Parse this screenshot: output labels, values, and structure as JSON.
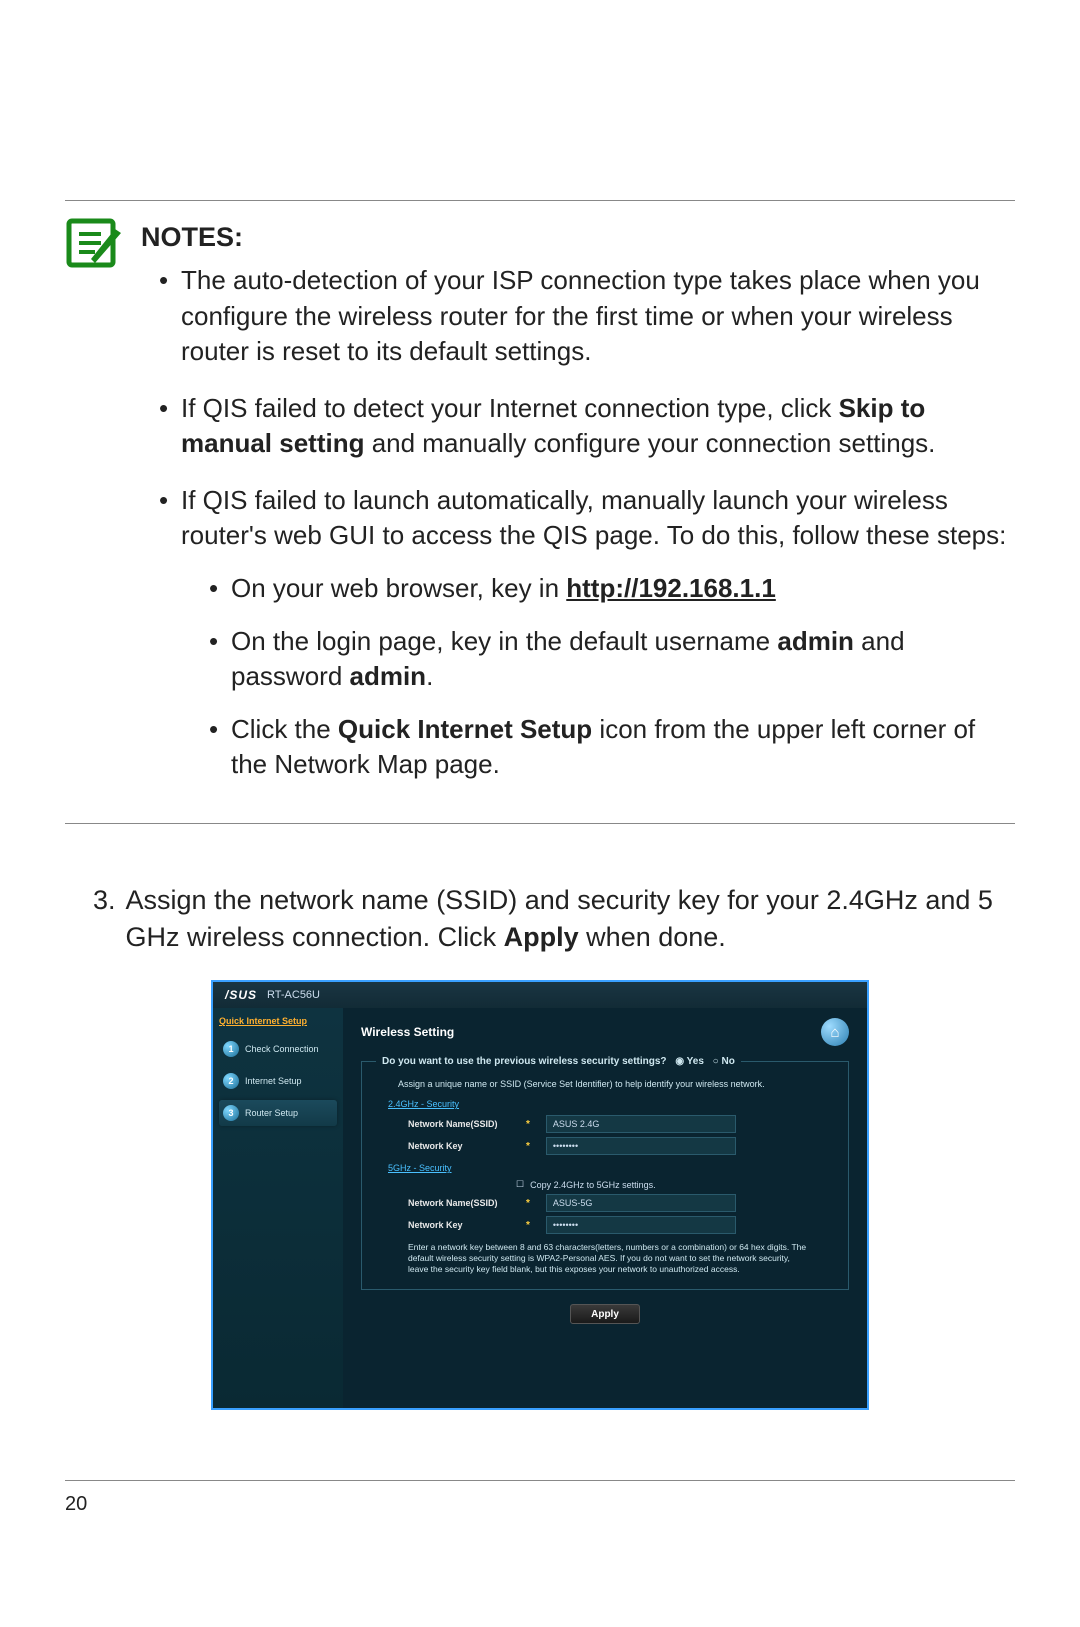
{
  "notes": {
    "title": "NOTES",
    "items": [
      {
        "text": "The auto-detection of your ISP connection type takes place when you configure the wireless router for the first time or when your wireless router is reset to its default settings."
      },
      {
        "prefix": "If QIS failed to detect your Internet connection type, click ",
        "b1": "Skip to manual setting",
        "suffix": " and manually configure your connection settings."
      },
      {
        "text": "If QIS failed to launch automatically, manually launch your wireless router's web GUI to access the QIS page. To do this, follow these steps:",
        "subitems": [
          {
            "prefix": "On your web browser, key in ",
            "bold_underline": "http://192.168.1.1"
          },
          {
            "prefix": "On the login page, key in the default username ",
            "b1": "admin",
            "mid": " and password ",
            "b2": "admin",
            "suffix": "."
          },
          {
            "prefix": "Click the ",
            "b1": "Quick Internet Setup",
            "suffix": " icon from the upper left corner of the Network Map page."
          }
        ]
      }
    ]
  },
  "step3": {
    "number": "3.",
    "text_a": "Assign the network name (SSID) and security key for your 2.4GHz and 5 GHz wireless connection. Click ",
    "bold": "Apply",
    "text_b": " when done."
  },
  "router": {
    "brand": "/SUS",
    "model": "RT-AC56U",
    "sidebar_title": "Quick Internet Setup",
    "sidebar": [
      {
        "num": "1",
        "label": "Check Connection"
      },
      {
        "num": "2",
        "label": "Internet Setup"
      },
      {
        "num": "3",
        "label": "Router Setup"
      }
    ],
    "panel_title": "Wireless Setting",
    "prev_question": "Do you want to use the previous wireless security settings?",
    "yes": "Yes",
    "no": "No",
    "assign_note": "Assign a unique name or SSID (Service Set Identifier) to help identify your wireless network.",
    "sec_24": "2.4GHz - Security",
    "sec_5": "5GHz - Security",
    "label_ssid": "Network Name(SSID)",
    "label_key": "Network Key",
    "val_ssid24": "ASUS 2.4G",
    "val_key": "••••••••",
    "copy_label": "Copy 2.4GHz to 5GHz settings.",
    "val_ssid5": "ASUS-5G",
    "warning": "Enter a network key between 8 and 63 characters(letters, numbers or a combination) or 64 hex digits. The default wireless security setting is WPA2-Personal AES. If you do not want to set the network security, leave the security key field blank, but this exposes your network to unauthorized access.",
    "apply": "Apply"
  },
  "page_number": "20"
}
